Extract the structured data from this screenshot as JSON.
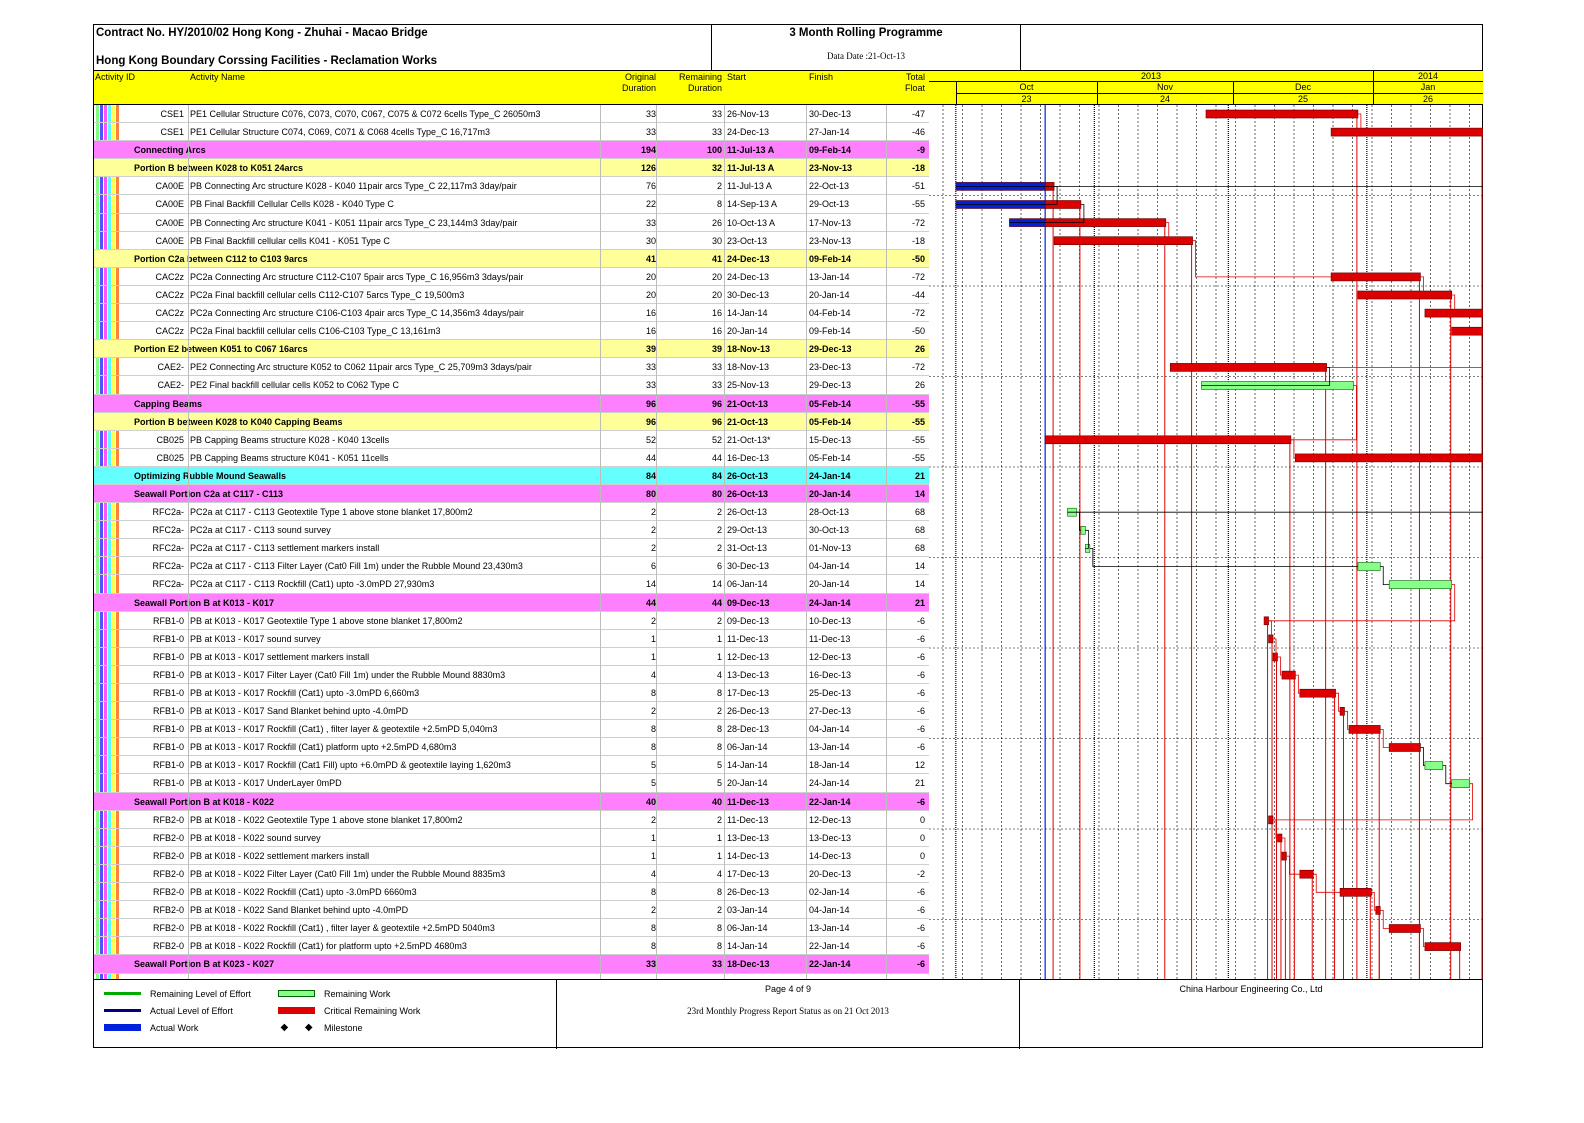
{
  "header": {
    "contract": "Contract No. HY/2010/02 Hong Kong - Zhuhai - Macao Bridge",
    "subtitle": "Hong Kong Boundary Corssing Facilities - Reclamation Works",
    "programme_title": "3 Month Rolling Programme",
    "data_date": "Data Date :21-Oct-13"
  },
  "columns": {
    "activity_id": "Activity ID",
    "activity_name": "Activity Name",
    "orig_1": "Original",
    "orig_2": "Duration",
    "rem_1": "Remaining",
    "rem_2": "Duration",
    "start": "Start",
    "finish": "Finish",
    "float_1": "Total",
    "float_2": "Float"
  },
  "timeline": {
    "years": [
      "2013",
      "2014"
    ],
    "months": [
      "Oct",
      "Nov",
      "Dec",
      "Jan"
    ],
    "weeks": [
      "23",
      "24",
      "25",
      "26"
    ]
  },
  "colors": {
    "header_yellow": "#ffff00",
    "group_magenta": "#ff80ff",
    "group_yellow": "#ffff99",
    "group_cyan": "#66ffff",
    "critical_red": "#dd0000",
    "remaining_green": "#88ff88",
    "actual_blue": "#0022dd"
  },
  "rows": [
    {
      "type": "act",
      "id": "CSE1",
      "name": "PE1 Cellular Structure C076, C073, C070, C067, C075 & C072 6cells Type_C 26050m3",
      "od": "33",
      "rd": "33",
      "st": "26-Nov-13",
      "fi": "30-Dec-13",
      "tf": "-47",
      "bars": [
        {
          "k": "crit",
          "s": "2013-11-26",
          "e": "2013-12-30"
        }
      ]
    },
    {
      "type": "act",
      "id": "CSE1",
      "name": "PE1 Cellular Structure C074, C069, C071 & C068 4cells Type_C 16,717m3",
      "od": "33",
      "rd": "33",
      "st": "24-Dec-13",
      "fi": "27-Jan-14",
      "tf": "-46",
      "bars": [
        {
          "k": "crit",
          "s": "2013-12-24",
          "e": "2014-01-27"
        }
      ]
    },
    {
      "type": "grp",
      "g": "m",
      "name": "Connecting Arcs",
      "od": "194",
      "rd": "100",
      "st": "11-Jul-13 A",
      "fi": "09-Feb-14",
      "tf": "-9"
    },
    {
      "type": "grp",
      "g": "y",
      "name": "Portion B between K028 to K051 24arcs",
      "od": "126",
      "rd": "32",
      "st": "11-Jul-13 A",
      "fi": "23-Nov-13",
      "tf": "-18"
    },
    {
      "type": "act",
      "id": "CA00E",
      "name": "PB Connecting Arc structure K028 - K040 11pair arcs Type_C 22,117m3 3day/pair",
      "od": "76",
      "rd": "2",
      "st": "11-Jul-13 A",
      "fi": "22-Oct-13",
      "tf": "-51",
      "bars": [
        {
          "k": "act",
          "s": "2013-10-01",
          "e": "2013-10-21"
        },
        {
          "k": "crit",
          "s": "2013-10-21",
          "e": "2013-10-23"
        }
      ]
    },
    {
      "type": "act",
      "id": "CA00E",
      "name": "PB Final Backfill Cellular Cells K028 - K040 Type C",
      "od": "22",
      "rd": "8",
      "st": "14-Sep-13 A",
      "fi": "29-Oct-13",
      "tf": "-55",
      "bars": [
        {
          "k": "act",
          "s": "2013-10-01",
          "e": "2013-10-21"
        },
        {
          "k": "crit",
          "s": "2013-10-21",
          "e": "2013-10-29"
        }
      ]
    },
    {
      "type": "act",
      "id": "CA00E",
      "name": "PB Connecting Arc structure K041 - K051 11pair arcs Type_C 23,144m3 3day/pair",
      "od": "33",
      "rd": "26",
      "st": "10-Oct-13 A",
      "fi": "17-Nov-13",
      "tf": "-72",
      "bars": [
        {
          "k": "act",
          "s": "2013-10-13",
          "e": "2013-10-21"
        },
        {
          "k": "crit",
          "s": "2013-10-21",
          "e": "2013-11-17"
        }
      ]
    },
    {
      "type": "act",
      "id": "CA00E",
      "name": "PB Final Backfill cellular cells K041 - K051 Type C",
      "od": "30",
      "rd": "30",
      "st": "23-Oct-13",
      "fi": "23-Nov-13",
      "tf": "-18",
      "bars": [
        {
          "k": "crit",
          "s": "2013-10-23",
          "e": "2013-11-23"
        }
      ]
    },
    {
      "type": "grp",
      "g": "y",
      "name": "Portion C2a between C112 to C103 9arcs",
      "od": "41",
      "rd": "41",
      "st": "24-Dec-13",
      "fi": "09-Feb-14",
      "tf": "-50"
    },
    {
      "type": "act",
      "id": "CAC2z",
      "name": "PC2a Connecting Arc structure C112-C107 5pair arcs Type_C 16,956m3 3days/pair",
      "od": "20",
      "rd": "20",
      "st": "24-Dec-13",
      "fi": "13-Jan-14",
      "tf": "-72",
      "bars": [
        {
          "k": "crit",
          "s": "2013-12-24",
          "e": "2014-01-13"
        }
      ]
    },
    {
      "type": "act",
      "id": "CAC2z",
      "name": "PC2a Final backfill cellular cells C112-C107 5arcs Type_C 19,500m3",
      "od": "20",
      "rd": "20",
      "st": "30-Dec-13",
      "fi": "20-Jan-14",
      "tf": "-44",
      "bars": [
        {
          "k": "crit",
          "s": "2013-12-30",
          "e": "2014-01-20"
        }
      ]
    },
    {
      "type": "act",
      "id": "CAC2z",
      "name": "PC2a Connecting Arc structure C106-C103 4pair arcs Type_C 14,356m3 4days/pair",
      "od": "16",
      "rd": "16",
      "st": "14-Jan-14",
      "fi": "04-Feb-14",
      "tf": "-72",
      "bars": [
        {
          "k": "crit",
          "s": "2014-01-14",
          "e": "2014-01-27"
        }
      ]
    },
    {
      "type": "act",
      "id": "CAC2z",
      "name": "PC2a Final backfill cellular cells C106-C103 Type_C 13,161m3",
      "od": "16",
      "rd": "16",
      "st": "20-Jan-14",
      "fi": "09-Feb-14",
      "tf": "-50",
      "bars": [
        {
          "k": "crit",
          "s": "2014-01-20",
          "e": "2014-01-27"
        }
      ]
    },
    {
      "type": "grp",
      "g": "y",
      "name": "Portion E2 between K051 to C067 16arcs",
      "od": "39",
      "rd": "39",
      "st": "18-Nov-13",
      "fi": "29-Dec-13",
      "tf": "26"
    },
    {
      "type": "act",
      "id": "CAE2-",
      "name": "PE2 Connecting Arc structure K052 to C062 11pair arcs Type_C 25,709m3 3days/pair",
      "od": "33",
      "rd": "33",
      "st": "18-Nov-13",
      "fi": "23-Dec-13",
      "tf": "-72",
      "bars": [
        {
          "k": "crit",
          "s": "2013-11-18",
          "e": "2013-12-23"
        }
      ]
    },
    {
      "type": "act",
      "id": "CAE2-",
      "name": "PE2 Final backfill cellular cells K052 to C062 Type C",
      "od": "33",
      "rd": "33",
      "st": "25-Nov-13",
      "fi": "29-Dec-13",
      "tf": "26",
      "bars": [
        {
          "k": "rem",
          "s": "2013-11-25",
          "e": "2013-12-29"
        }
      ]
    },
    {
      "type": "grp",
      "g": "m",
      "name": "Capping Beams",
      "od": "96",
      "rd": "96",
      "st": "21-Oct-13",
      "fi": "05-Feb-14",
      "tf": "-55"
    },
    {
      "type": "grp",
      "g": "y",
      "name": "Portion B between K028 to K040 Capping Beams",
      "od": "96",
      "rd": "96",
      "st": "21-Oct-13",
      "fi": "05-Feb-14",
      "tf": "-55"
    },
    {
      "type": "act",
      "id": "CB025",
      "name": "PB Capping Beams structure K028 - K040 13cells",
      "od": "52",
      "rd": "52",
      "st": "21-Oct-13*",
      "fi": "15-Dec-13",
      "tf": "-55",
      "bars": [
        {
          "k": "crit",
          "s": "2013-10-21",
          "e": "2013-12-15"
        }
      ]
    },
    {
      "type": "act",
      "id": "CB025",
      "name": "PB Capping Beams structure K041 - K051 11cells",
      "od": "44",
      "rd": "44",
      "st": "16-Dec-13",
      "fi": "05-Feb-14",
      "tf": "-55",
      "bars": [
        {
          "k": "crit",
          "s": "2013-12-16",
          "e": "2014-01-27"
        }
      ]
    },
    {
      "type": "grp",
      "g": "c",
      "name": "Optimizing Rubble Mound Seawalls",
      "od": "84",
      "rd": "84",
      "st": "26-Oct-13",
      "fi": "24-Jan-14",
      "tf": "21"
    },
    {
      "type": "grp",
      "g": "m",
      "name": "Seawall Portion C2a at C117 - C113",
      "od": "80",
      "rd": "80",
      "st": "26-Oct-13",
      "fi": "20-Jan-14",
      "tf": "14"
    },
    {
      "type": "act",
      "id": "RFC2a-",
      "name": "PC2a at C117 - C113 Geotextile Type 1 above stone blanket 17,800m2",
      "od": "2",
      "rd": "2",
      "st": "26-Oct-13",
      "fi": "28-Oct-13",
      "tf": "68",
      "bars": [
        {
          "k": "rem",
          "s": "2013-10-26",
          "e": "2013-10-28"
        }
      ]
    },
    {
      "type": "act",
      "id": "RFC2a-",
      "name": "PC2a at C117 - C113 sound survey",
      "od": "2",
      "rd": "2",
      "st": "29-Oct-13",
      "fi": "30-Oct-13",
      "tf": "68",
      "bars": [
        {
          "k": "rem",
          "s": "2013-10-29",
          "e": "2013-10-30"
        }
      ]
    },
    {
      "type": "act",
      "id": "RFC2a-",
      "name": "PC2a at C117 - C113 settlement markers install",
      "od": "2",
      "rd": "2",
      "st": "31-Oct-13",
      "fi": "01-Nov-13",
      "tf": "68",
      "bars": [
        {
          "k": "rem",
          "s": "2013-10-30",
          "e": "2013-10-31"
        }
      ]
    },
    {
      "type": "act",
      "id": "RFC2a-",
      "name": "PC2a at C117 - C113 Filter Layer (Cat0 Fill 1m) under the Rubble Mound 23,430m3",
      "od": "6",
      "rd": "6",
      "st": "30-Dec-13",
      "fi": "04-Jan-14",
      "tf": "14",
      "bars": [
        {
          "k": "rem",
          "s": "2013-12-30",
          "e": "2014-01-04"
        }
      ]
    },
    {
      "type": "act",
      "id": "RFC2a-",
      "name": "PC2a at C117 - C113 Rockfill (Cat1) upto -3.0mPD 27,930m3",
      "od": "14",
      "rd": "14",
      "st": "06-Jan-14",
      "fi": "20-Jan-14",
      "tf": "14",
      "bars": [
        {
          "k": "rem",
          "s": "2014-01-06",
          "e": "2014-01-20"
        }
      ]
    },
    {
      "type": "grp",
      "g": "m",
      "name": "Seawall Portion B at K013 - K017",
      "od": "44",
      "rd": "44",
      "st": "09-Dec-13",
      "fi": "24-Jan-14",
      "tf": "21"
    },
    {
      "type": "act",
      "id": "RFB1-0",
      "name": "PB at K013 - K017 Geotextile Type 1 above stone blanket 17,800m2",
      "od": "2",
      "rd": "2",
      "st": "09-Dec-13",
      "fi": "10-Dec-13",
      "tf": "-6",
      "bars": [
        {
          "k": "crit",
          "s": "2013-12-09",
          "e": "2013-12-10"
        }
      ]
    },
    {
      "type": "act",
      "id": "RFB1-0",
      "name": "PB at K013 - K017 sound survey",
      "od": "1",
      "rd": "1",
      "st": "11-Dec-13",
      "fi": "11-Dec-13",
      "tf": "-6",
      "bars": [
        {
          "k": "crit",
          "s": "2013-12-10",
          "e": "2013-12-11"
        }
      ]
    },
    {
      "type": "act",
      "id": "RFB1-0",
      "name": "PB at K013 - K017 settlement markers install",
      "od": "1",
      "rd": "1",
      "st": "12-Dec-13",
      "fi": "12-Dec-13",
      "tf": "-6",
      "bars": [
        {
          "k": "crit",
          "s": "2013-12-11",
          "e": "2013-12-12"
        }
      ]
    },
    {
      "type": "act",
      "id": "RFB1-0",
      "name": "PB at K013 - K017 Filter Layer (Cat0 Fill 1m) under the Rubble Mound 8830m3",
      "od": "4",
      "rd": "4",
      "st": "13-Dec-13",
      "fi": "16-Dec-13",
      "tf": "-6",
      "bars": [
        {
          "k": "crit",
          "s": "2013-12-13",
          "e": "2013-12-16"
        }
      ]
    },
    {
      "type": "act",
      "id": "RFB1-0",
      "name": "PB at K013 - K017 Rockfill (Cat1) upto -3.0mPD 6,660m3",
      "od": "8",
      "rd": "8",
      "st": "17-Dec-13",
      "fi": "25-Dec-13",
      "tf": "-6",
      "bars": [
        {
          "k": "crit",
          "s": "2013-12-17",
          "e": "2013-12-25"
        }
      ]
    },
    {
      "type": "act",
      "id": "RFB1-0",
      "name": "PB at K013 - K017 Sand Blanket behind upto -4.0mPD",
      "od": "2",
      "rd": "2",
      "st": "26-Dec-13",
      "fi": "27-Dec-13",
      "tf": "-6",
      "bars": [
        {
          "k": "crit",
          "s": "2013-12-26",
          "e": "2013-12-27"
        }
      ]
    },
    {
      "type": "act",
      "id": "RFB1-0",
      "name": "PB at K013 - K017 Rockfill (Cat1) , filter layer & geotextile +2.5mPD 5,040m3",
      "od": "8",
      "rd": "8",
      "st": "28-Dec-13",
      "fi": "04-Jan-14",
      "tf": "-6",
      "bars": [
        {
          "k": "crit",
          "s": "2013-12-28",
          "e": "2014-01-04"
        }
      ]
    },
    {
      "type": "act",
      "id": "RFB1-0",
      "name": "PB at K013 - K017 Rockfill (Cat1) platform upto +2.5mPD 4,680m3",
      "od": "8",
      "rd": "8",
      "st": "06-Jan-14",
      "fi": "13-Jan-14",
      "tf": "-6",
      "bars": [
        {
          "k": "crit",
          "s": "2014-01-06",
          "e": "2014-01-13"
        }
      ]
    },
    {
      "type": "act",
      "id": "RFB1-0",
      "name": "PB at K013 - K017 Rockfill (Cat1 Fill) upto +6.0mPD & geotextile laying 1,620m3",
      "od": "5",
      "rd": "5",
      "st": "14-Jan-14",
      "fi": "18-Jan-14",
      "tf": "12",
      "bars": [
        {
          "k": "rem",
          "s": "2014-01-14",
          "e": "2014-01-18"
        }
      ]
    },
    {
      "type": "act",
      "id": "RFB1-0",
      "name": "PB at K013 - K017 UnderLayer 0mPD",
      "od": "5",
      "rd": "5",
      "st": "20-Jan-14",
      "fi": "24-Jan-14",
      "tf": "21",
      "bars": [
        {
          "k": "rem",
          "s": "2014-01-20",
          "e": "2014-01-24"
        }
      ]
    },
    {
      "type": "grp",
      "g": "m",
      "name": "Seawall Portion B at K018 - K022",
      "od": "40",
      "rd": "40",
      "st": "11-Dec-13",
      "fi": "22-Jan-14",
      "tf": "-6"
    },
    {
      "type": "act",
      "id": "RFB2-0",
      "name": "PB at K018 - K022 Geotextile Type 1 above stone blanket 17,800m2",
      "od": "2",
      "rd": "2",
      "st": "11-Dec-13",
      "fi": "12-Dec-13",
      "tf": "0",
      "bars": [
        {
          "k": "crit",
          "s": "2013-12-10",
          "e": "2013-12-11"
        }
      ]
    },
    {
      "type": "act",
      "id": "RFB2-0",
      "name": "PB at K018 - K022 sound survey",
      "od": "1",
      "rd": "1",
      "st": "13-Dec-13",
      "fi": "13-Dec-13",
      "tf": "0",
      "bars": [
        {
          "k": "crit",
          "s": "2013-12-12",
          "e": "2013-12-13"
        }
      ]
    },
    {
      "type": "act",
      "id": "RFB2-0",
      "name": "PB at K018 - K022 settlement markers install",
      "od": "1",
      "rd": "1",
      "st": "14-Dec-13",
      "fi": "14-Dec-13",
      "tf": "0",
      "bars": [
        {
          "k": "crit",
          "s": "2013-12-13",
          "e": "2013-12-14"
        }
      ]
    },
    {
      "type": "act",
      "id": "RFB2-0",
      "name": "PB at K018 - K022 Filter Layer (Cat0 Fill 1m) under the Rubble Mound 8835m3",
      "od": "4",
      "rd": "4",
      "st": "17-Dec-13",
      "fi": "20-Dec-13",
      "tf": "-2",
      "bars": [
        {
          "k": "crit",
          "s": "2013-12-17",
          "e": "2013-12-20"
        }
      ]
    },
    {
      "type": "act",
      "id": "RFB2-0",
      "name": "PB at K018 - K022 Rockfill (Cat1) upto -3.0mPD 6660m3",
      "od": "8",
      "rd": "8",
      "st": "26-Dec-13",
      "fi": "02-Jan-14",
      "tf": "-6",
      "bars": [
        {
          "k": "crit",
          "s": "2013-12-26",
          "e": "2014-01-02"
        }
      ]
    },
    {
      "type": "act",
      "id": "RFB2-0",
      "name": "PB at K018 - K022 Sand Blanket behind upto -4.0mPD",
      "od": "2",
      "rd": "2",
      "st": "03-Jan-14",
      "fi": "04-Jan-14",
      "tf": "-6",
      "bars": [
        {
          "k": "crit",
          "s": "2014-01-03",
          "e": "2014-01-04"
        }
      ]
    },
    {
      "type": "act",
      "id": "RFB2-0",
      "name": "PB at K018 - K022 Rockfill (Cat1) , filter layer & geotextile +2.5mPD 5040m3",
      "od": "8",
      "rd": "8",
      "st": "06-Jan-14",
      "fi": "13-Jan-14",
      "tf": "-6",
      "bars": [
        {
          "k": "crit",
          "s": "2014-01-06",
          "e": "2014-01-13"
        }
      ]
    },
    {
      "type": "act",
      "id": "RFB2-0",
      "name": "PB at K018 - K022 Rockfill (Cat1) for platform upto +2.5mPD 4680m3",
      "od": "8",
      "rd": "8",
      "st": "14-Jan-14",
      "fi": "22-Jan-14",
      "tf": "-6",
      "bars": [
        {
          "k": "crit",
          "s": "2014-01-14",
          "e": "2014-01-22"
        }
      ]
    },
    {
      "type": "grp",
      "g": "m",
      "name": "Seawall Portion B at K023 - K027",
      "od": "33",
      "rd": "33",
      "st": "18-Dec-13",
      "fi": "22-Jan-14",
      "tf": "-6"
    }
  ],
  "legend": {
    "remaining_loe": "Remaining Level of Effort",
    "actual_loe": "Actual Level of Effort",
    "actual_work": "Actual Work",
    "remaining_work": "Remaining Work",
    "critical_remaining": "Critical Remaining Work",
    "milestone": "Milestone"
  },
  "footer": {
    "page": "Page 4 of 9",
    "report": "23rd Monthly Progress Report Status as on 21 Oct 2013",
    "company": "China Harbour Engineering Co., Ltd"
  }
}
